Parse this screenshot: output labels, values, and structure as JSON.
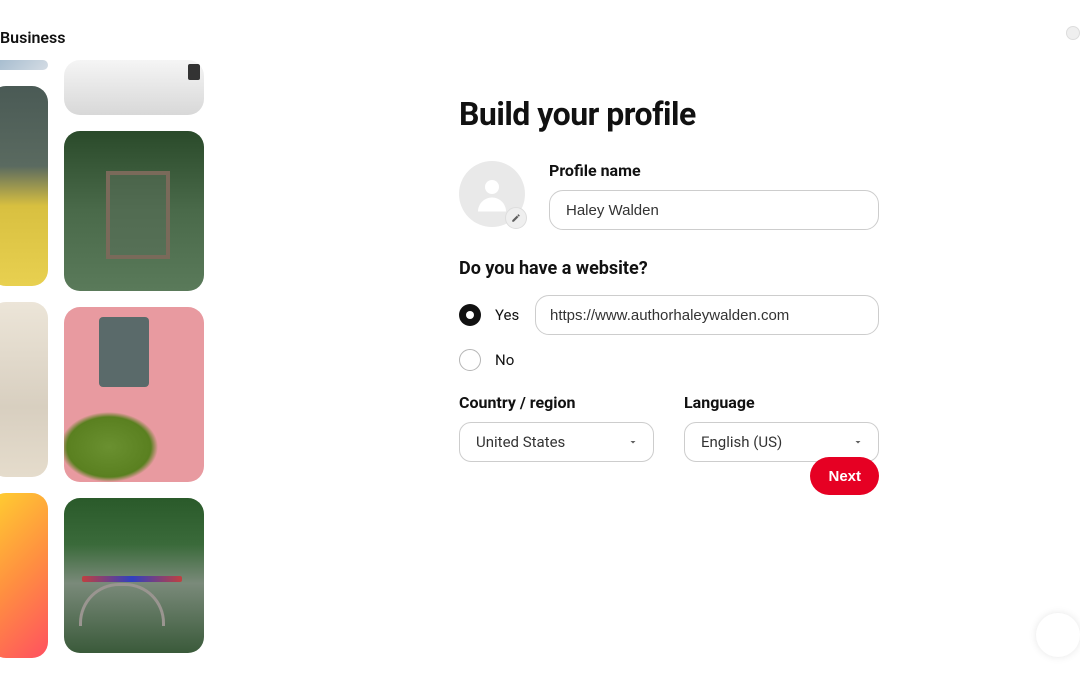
{
  "header": {
    "brand": "Business"
  },
  "form": {
    "title": "Build your profile",
    "profile_name_label": "Profile name",
    "profile_name_value": "Haley Walden",
    "website_question": "Do you have a website?",
    "website_yes": "Yes",
    "website_no": "No",
    "website_url": "https://www.authorhaleywalden.com",
    "country_label": "Country / region",
    "country_value": "United States",
    "language_label": "Language",
    "language_value": "English (US)",
    "next_label": "Next"
  }
}
